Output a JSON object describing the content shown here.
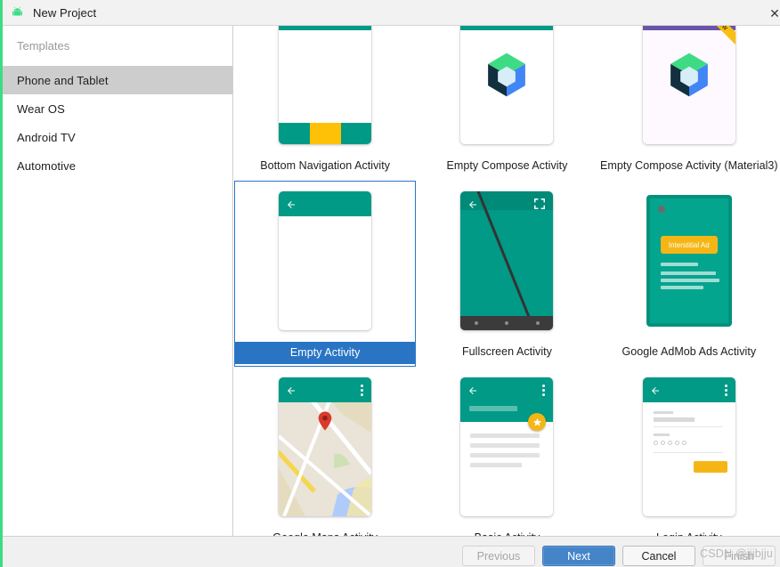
{
  "window": {
    "title": "New Project",
    "icon": "android-robot-icon",
    "close_label": "✕"
  },
  "sidebar": {
    "header": "Templates",
    "items": [
      {
        "label": "Phone and Tablet",
        "selected": true
      },
      {
        "label": "Wear OS",
        "selected": false
      },
      {
        "label": "Android TV",
        "selected": false
      },
      {
        "label": "Automotive",
        "selected": false
      }
    ]
  },
  "templates": {
    "rows": [
      [
        {
          "label": "Bottom Navigation Activity",
          "art": "bottom-nav",
          "selected": false
        },
        {
          "label": "Empty Compose Activity",
          "art": "compose",
          "selected": false
        },
        {
          "label": "Empty Compose Activity (Material3)",
          "art": "compose-m3",
          "badge": "PREVIEW",
          "selected": false
        }
      ],
      [
        {
          "label": "Empty Activity",
          "art": "empty",
          "selected": true
        },
        {
          "label": "Fullscreen Activity",
          "art": "fullscreen",
          "selected": false
        },
        {
          "label": "Google AdMob Ads Activity",
          "art": "admob",
          "ad_label": "Interstitial Ad",
          "selected": false
        }
      ],
      [
        {
          "label": "Google Maps Activity",
          "art": "maps",
          "selected": false
        },
        {
          "label": "Basic Activity",
          "art": "basic",
          "selected": false
        },
        {
          "label": "Login Activity",
          "art": "login",
          "selected": false
        }
      ]
    ]
  },
  "footer": {
    "previous_label": "Previous",
    "next_label": "Next",
    "cancel_label": "Cancel",
    "finish_label": "Finish",
    "watermark": "CSDN @jjjbjju"
  },
  "colors": {
    "teal": "#009a86",
    "amber": "#ffc107",
    "purple": "#6a53a8",
    "selection_blue": "#2a74c4",
    "android_green": "#3ddc84"
  }
}
